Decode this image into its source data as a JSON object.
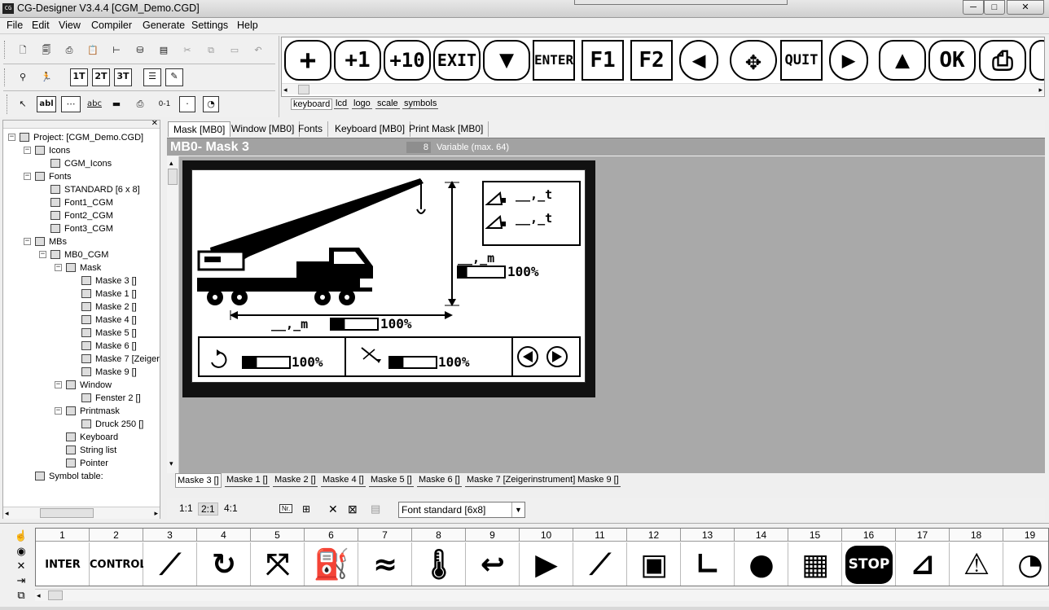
{
  "window": {
    "title": "CG-Designer V3.4.4 [CGM_Demo.CGD]",
    "app_icon": "cg-app-icon",
    "minimize": "─",
    "maximize": "□",
    "close": "✕"
  },
  "menu": [
    "File",
    "Edit",
    "View",
    "Compiler",
    "Generate",
    "Settings",
    "Help"
  ],
  "toolbar": {
    "row1": [
      "new-icon",
      "open-icon",
      "print-icon",
      "clipboard-icon",
      "tree-icon",
      "network-icon",
      "document-icon",
      "cut-icon",
      "copy-icon",
      "paste-icon",
      "undo-icon"
    ],
    "row2": [
      "find-icon",
      "run-icon",
      "font1-icon",
      "font2-icon",
      "font3-icon",
      "list-icon",
      "edit-icon"
    ],
    "row2_labels": {
      "font1": "1T",
      "font2": "2T",
      "font3": "3T"
    },
    "row3": [
      "pointer-icon",
      "text-field-icon",
      "line-icon",
      "spellcheck-icon",
      "bar-icon",
      "print-field-icon",
      "toggle-icon",
      "center-icon",
      "gauge-icon"
    ],
    "row3_labels": {
      "text": "abl",
      "spell": "abc",
      "toggle": "0-1"
    }
  },
  "keys": [
    {
      "name": "key-plus",
      "label": "+"
    },
    {
      "name": "key-plus1",
      "label": "+1"
    },
    {
      "name": "key-plus10",
      "label": "+10"
    },
    {
      "name": "key-exit",
      "label": "EXIT"
    },
    {
      "name": "key-down",
      "label": "▼"
    },
    {
      "name": "key-enter",
      "label": "ENTER"
    },
    {
      "name": "key-f1",
      "label": "F1"
    },
    {
      "name": "key-f2",
      "label": "F2"
    },
    {
      "name": "key-left",
      "label": "◀"
    },
    {
      "name": "key-dpad",
      "label": "✥"
    },
    {
      "name": "key-quit",
      "label": "QUIT"
    },
    {
      "name": "key-right",
      "label": "▶"
    },
    {
      "name": "key-up",
      "label": "▲"
    },
    {
      "name": "key-ok",
      "label": "OK"
    },
    {
      "name": "key-printer",
      "label": "⎙"
    }
  ],
  "key_tabs": [
    "keyboard",
    "lcd",
    "logo",
    "scale",
    "symbols"
  ],
  "tree": [
    {
      "label": "Project: [CGM_Demo.CGD]",
      "level": 0,
      "exp": "-"
    },
    {
      "label": "Icons",
      "level": 1,
      "exp": "-"
    },
    {
      "label": "CGM_Icons",
      "level": 2,
      "exp": ""
    },
    {
      "label": "Fonts",
      "level": 1,
      "exp": "-"
    },
    {
      "label": "STANDARD [6 x 8]",
      "level": 2,
      "exp": ""
    },
    {
      "label": "Font1_CGM",
      "level": 2,
      "exp": ""
    },
    {
      "label": "Font2_CGM",
      "level": 2,
      "exp": ""
    },
    {
      "label": "Font3_CGM",
      "level": 2,
      "exp": ""
    },
    {
      "label": "MBs",
      "level": 1,
      "exp": "-"
    },
    {
      "label": "MB0_CGM",
      "level": 2,
      "exp": "-"
    },
    {
      "label": "Mask",
      "level": 3,
      "exp": "-"
    },
    {
      "label": "Maske 3 []",
      "level": 4,
      "exp": ""
    },
    {
      "label": "Maske 1 []",
      "level": 4,
      "exp": ""
    },
    {
      "label": "Maske 2 []",
      "level": 4,
      "exp": ""
    },
    {
      "label": "Maske 4 []",
      "level": 4,
      "exp": ""
    },
    {
      "label": "Maske 5 []",
      "level": 4,
      "exp": ""
    },
    {
      "label": "Maske 6 []",
      "level": 4,
      "exp": ""
    },
    {
      "label": "Maske 7 [Zeiger",
      "level": 4,
      "exp": ""
    },
    {
      "label": "Maske 9 []",
      "level": 4,
      "exp": ""
    },
    {
      "label": "Window",
      "level": 3,
      "exp": "-"
    },
    {
      "label": "Fenster 2 []",
      "level": 4,
      "exp": ""
    },
    {
      "label": "Printmask",
      "level": 3,
      "exp": "-"
    },
    {
      "label": "Druck 250 []",
      "level": 4,
      "exp": ""
    },
    {
      "label": "Keyboard",
      "level": 3,
      "exp": ""
    },
    {
      "label": "String list",
      "level": 3,
      "exp": ""
    },
    {
      "label": "Pointer",
      "level": 3,
      "exp": ""
    },
    {
      "label": "Symbol table:",
      "level": 1,
      "exp": ""
    }
  ],
  "doc_tabs": [
    "Mask [MB0]",
    "Window [MB0]",
    "Fonts",
    "Keyboard [MB0]",
    "Print Mask [MB0]"
  ],
  "mask_header": {
    "title": "MB0- Mask 3",
    "count": "8",
    "variable_label": "Variable (max. 64)"
  },
  "lcd": {
    "load1": "__,_t",
    "load2": "__,_t",
    "height_value": "__,_m",
    "height_pct": "100%",
    "radius_value": "__,_m",
    "radius_pct": "100%",
    "slew_pct": "100%",
    "angle_pct": "100%",
    "height_fill": 0.2,
    "radius_fill": 0.3,
    "slew_fill": 0.3,
    "angle_fill": 0.3
  },
  "mask_tabs": [
    "Maske 3 []",
    "Maske 1 []",
    "Maske 2 []",
    "Maske 4 []",
    "Maske 5 []",
    "Maske 6 []",
    "Maske 7 [Zeigerinstrument]",
    "Maske 9 []"
  ],
  "zoom": [
    "1:1",
    "2:1",
    "4:1"
  ],
  "zoom_active": "2:1",
  "status_icons": {
    "nr": "Nr.",
    "ins": "⊞",
    "del": "✕",
    "delall": "⊠",
    "img": "▤"
  },
  "font_select": "Font standard [6x8]",
  "symbols": [
    {
      "n": "1",
      "name": "inter-logo-symbol",
      "glyph": "INTER"
    },
    {
      "n": "2",
      "name": "control-logo-symbol",
      "glyph": "CONTROL CGC"
    },
    {
      "n": "3",
      "name": "crane-spring-symbol",
      "glyph": "⟋"
    },
    {
      "n": "4",
      "name": "rotate-symbol",
      "glyph": "↻"
    },
    {
      "n": "5",
      "name": "angle-symbol",
      "glyph": "⤧"
    },
    {
      "n": "6",
      "name": "fuel-symbol",
      "glyph": "⛽"
    },
    {
      "n": "7",
      "name": "oil-symbol",
      "glyph": "≈"
    },
    {
      "n": "8",
      "name": "temperature-symbol",
      "glyph": "🌡"
    },
    {
      "n": "9",
      "name": "return-symbol",
      "glyph": "↩"
    },
    {
      "n": "10",
      "name": "play-symbol",
      "glyph": "▶"
    },
    {
      "n": "11",
      "name": "crane-symbol",
      "glyph": "⟋"
    },
    {
      "n": "12",
      "name": "square-symbol",
      "glyph": "▣"
    },
    {
      "n": "13",
      "name": "corner-symbol",
      "glyph": "∟"
    },
    {
      "n": "14",
      "name": "circle-symbol",
      "glyph": "●"
    },
    {
      "n": "15",
      "name": "checker-symbol",
      "glyph": "▦"
    },
    {
      "n": "16",
      "name": "stop-symbol",
      "glyph": "STOP"
    },
    {
      "n": "17",
      "name": "forklift-symbol",
      "glyph": "⊿"
    },
    {
      "n": "18",
      "name": "warning-symbol",
      "glyph": "⚠"
    },
    {
      "n": "19",
      "name": "gauge-symbol",
      "glyph": "◔"
    }
  ],
  "sym_side_icons": [
    "hand-icon",
    "eye-icon",
    "close-icon",
    "export-icon",
    "import-icon"
  ]
}
